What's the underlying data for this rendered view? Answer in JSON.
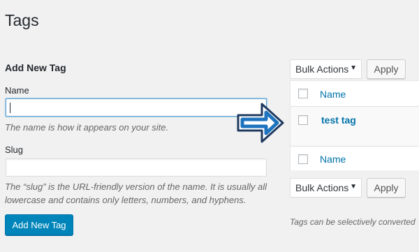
{
  "page": {
    "title": "Tags"
  },
  "form": {
    "heading": "Add New Tag",
    "name_label": "Name",
    "name_value": "",
    "name_description": "The name is how it appears on your site.",
    "slug_label": "Slug",
    "slug_value": "",
    "slug_description": "The “slug” is the URL-friendly version of the name. It is usually all lowercase and contains only letters, numbers, and hyphens.",
    "submit_label": "Add New Tag"
  },
  "bulk_top": {
    "select_value": "Bulk Actions",
    "apply_label": "Apply"
  },
  "bulk_bottom": {
    "select_value": "Bulk Actions",
    "apply_label": "Apply"
  },
  "table": {
    "header_column": "Name",
    "footer_column": "Name",
    "rows": [
      {
        "name": "test tag"
      }
    ]
  },
  "footer_note": "Tags can be selectively converted",
  "icons": {
    "pointer": "arrow-right-icon",
    "dropdown": "chevron-down-icon"
  },
  "colors": {
    "primary": "#0085ba",
    "link": "#0073aa",
    "arrow_blue": "#1e73be"
  }
}
